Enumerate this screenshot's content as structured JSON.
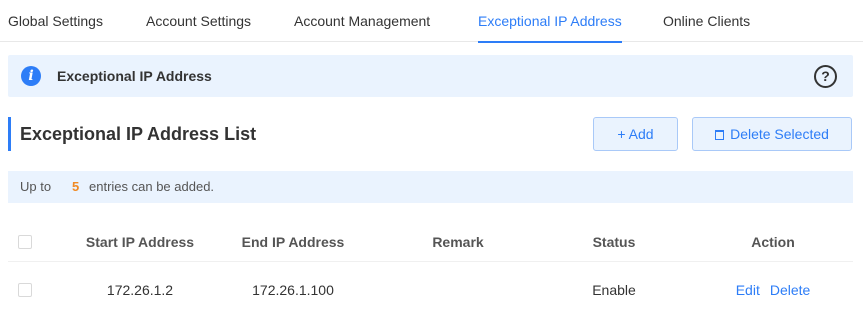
{
  "tabs": [
    {
      "label": "Global Settings",
      "active": false
    },
    {
      "label": "Account Settings",
      "active": false
    },
    {
      "label": "Account Management",
      "active": false
    },
    {
      "label": "Exceptional IP Address",
      "active": true
    },
    {
      "label": "Online Clients",
      "active": false
    }
  ],
  "banner": {
    "icon": "info-icon",
    "title": "Exceptional IP Address",
    "help_icon": "help-icon"
  },
  "section": {
    "title": "Exceptional IP Address List",
    "add_label": "+ Add",
    "delete_label": "Delete Selected"
  },
  "note": {
    "prefix": "Up to",
    "count": "5",
    "suffix": "entries can be added."
  },
  "table": {
    "headers": {
      "start_ip": "Start IP Address",
      "end_ip": "End IP Address",
      "remark": "Remark",
      "status": "Status",
      "action": "Action"
    },
    "rows": [
      {
        "start_ip": "172.26.1.2",
        "end_ip": "172.26.1.100",
        "remark": "",
        "status": "Enable",
        "edit": "Edit",
        "delete": "Delete"
      }
    ]
  },
  "colors": {
    "accent": "#2d7df7",
    "banner_bg": "#eaf3fe",
    "count_highlight": "#f08a24"
  }
}
